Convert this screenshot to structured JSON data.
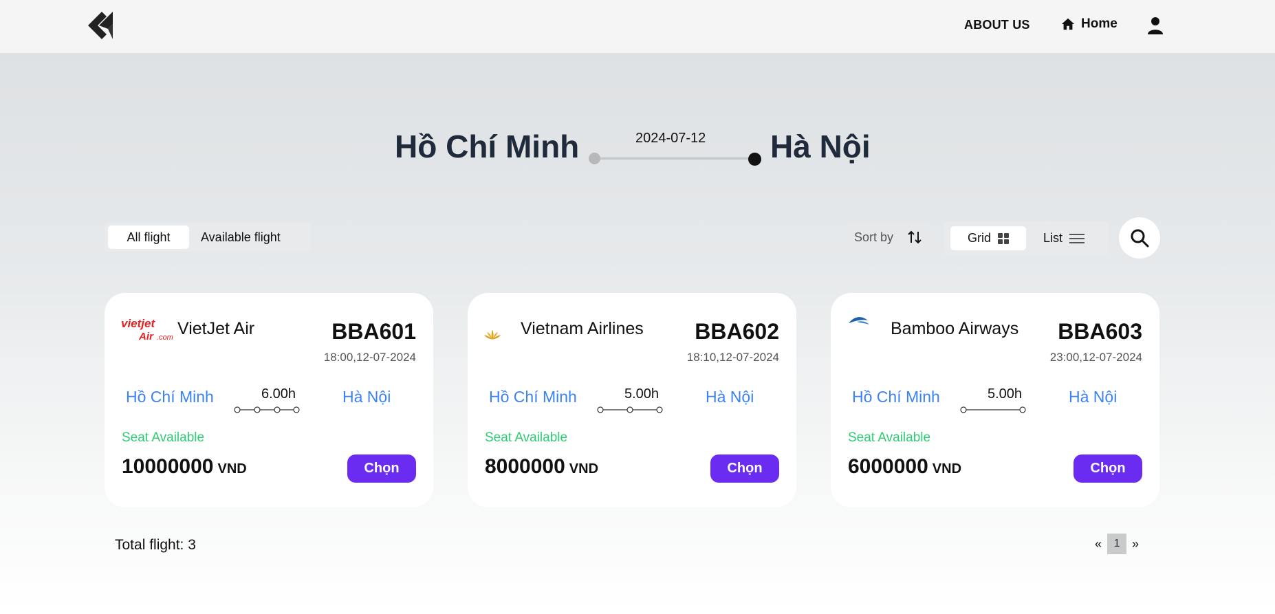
{
  "nav": {
    "about": "ABOUT US",
    "home": "Home"
  },
  "route": {
    "from": "Hồ Chí Minh",
    "to": "Hà Nội",
    "date": "2024-07-12"
  },
  "filters": {
    "all": "All flight",
    "available": "Available flight"
  },
  "controls": {
    "sort": "Sort by",
    "grid": "Grid",
    "list": "List"
  },
  "flights": [
    {
      "airline": "VietJet Air",
      "logo": "vietjet-logo",
      "code": "BBA601",
      "time": "18:00,12-07-2024",
      "from": "Hồ Chí Minh",
      "to": "Hà Nội",
      "duration": "6.00h",
      "stops": 2,
      "seat": "Seat Available",
      "price": "10000000",
      "currency": "VND",
      "button": "Chọn"
    },
    {
      "airline": "Vietnam Airlines",
      "logo": "lotus-logo",
      "code": "BBA602",
      "time": "18:10,12-07-2024",
      "from": "Hồ Chí Minh",
      "to": "Hà Nội",
      "duration": "5.00h",
      "stops": 1,
      "seat": "Seat Available",
      "price": "8000000",
      "currency": "VND",
      "button": "Chọn"
    },
    {
      "airline": "Bamboo Airways",
      "logo": "bamboo-logo",
      "code": "BBA603",
      "time": "23:00,12-07-2024",
      "from": "Hồ Chí Minh",
      "to": "Hà Nội",
      "duration": "5.00h",
      "stops": 0,
      "seat": "Seat Available",
      "price": "6000000",
      "currency": "VND",
      "button": "Chọn"
    }
  ],
  "footer": {
    "total": "Total flight: 3",
    "prev": "«",
    "page": "1",
    "next": "»"
  },
  "colors": {
    "accent": "#6a2cf0",
    "city": "#3b82f6",
    "seat": "#2ecc71"
  }
}
